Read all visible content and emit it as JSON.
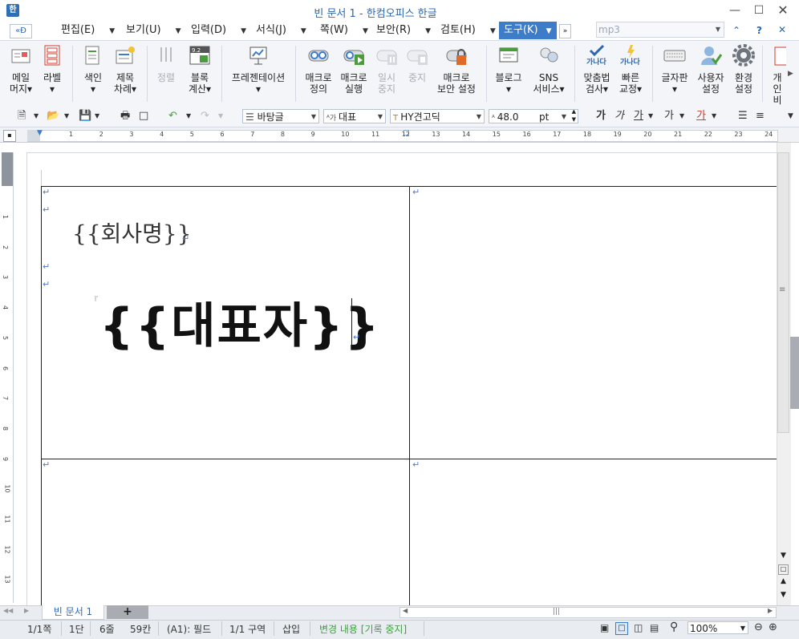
{
  "window": {
    "title": "빈 문서 1 - 한컴오피스 한글",
    "app_icon": "hwp-icon"
  },
  "menu": {
    "items": [
      {
        "label": "편집(E)"
      },
      {
        "label": "보기(U)"
      },
      {
        "label": "입력(D)"
      },
      {
        "label": "서식(J)"
      },
      {
        "label": "쪽(W)"
      },
      {
        "label": "보안(R)"
      },
      {
        "label": "검토(H)"
      },
      {
        "label": "도구(K)",
        "active": true
      }
    ],
    "search_value": "mp3"
  },
  "ribbon": {
    "buttons": [
      {
        "line1": "메일",
        "line2": "머지▾",
        "icon": "mail-merge-icon"
      },
      {
        "line1": "라벨",
        "line2": "▾",
        "icon": "label-icon"
      },
      {
        "line1": "색인",
        "line2": "▾",
        "icon": "index-icon"
      },
      {
        "line1": "제목",
        "line2": "차례▾",
        "icon": "toc-icon"
      },
      {
        "line1": "정렬",
        "line2": "",
        "icon": "sort-icon",
        "disabled": true
      },
      {
        "line1": "블록",
        "line2": "계산▾",
        "icon": "block-calc-icon"
      },
      {
        "line1": "프레젠테이션",
        "line2": "▾",
        "icon": "presentation-icon"
      },
      {
        "line1": "매크로",
        "line2": "정의",
        "icon": "macro-define-icon"
      },
      {
        "line1": "매크로",
        "line2": "실행",
        "icon": "macro-run-icon"
      },
      {
        "line1": "일시",
        "line2": "중지",
        "icon": "pause-icon",
        "disabled": true
      },
      {
        "line1": "중지",
        "line2": "",
        "icon": "stop-icon",
        "disabled": true
      },
      {
        "line1": "매크로",
        "line2": "보안 설정",
        "icon": "macro-security-icon"
      },
      {
        "line1": "블로그",
        "line2": "▾",
        "icon": "blog-icon"
      },
      {
        "line1": "SNS",
        "line2": "서비스▾",
        "icon": "sns-icon"
      },
      {
        "line1": "맞춤법",
        "line2": "검사▾",
        "icon": "spellcheck-icon"
      },
      {
        "line1": "빠른",
        "line2": "교정▾",
        "icon": "quick-correct-icon"
      },
      {
        "line1": "글자판",
        "line2": "▾",
        "icon": "keyboard-icon"
      },
      {
        "line1": "사용자",
        "line2": "설정",
        "icon": "user-settings-icon"
      },
      {
        "line1": "환경",
        "line2": "설정",
        "icon": "settings-gear-icon"
      },
      {
        "line1": "개인",
        "line2": "비",
        "icon": "privacy-icon"
      }
    ]
  },
  "toolbar": {
    "style": "바탕글",
    "language": "대표",
    "font": "HY견고딕",
    "size": "48.0",
    "unit": "pt",
    "char_labels": [
      "가",
      "가",
      "가",
      "가",
      "가"
    ]
  },
  "ruler": {
    "numbers": [
      "1",
      "2",
      "3",
      "4",
      "5",
      "6",
      "7",
      "8",
      "9",
      "10",
      "11",
      "12",
      "13",
      "14",
      "15",
      "16",
      "17",
      "18",
      "19",
      "20",
      "21",
      "22",
      "23",
      "24"
    ]
  },
  "vruler": {
    "numbers": [
      "1",
      "2",
      "3",
      "4",
      "5",
      "6",
      "7",
      "8",
      "9",
      "10",
      "11",
      "12",
      "13"
    ]
  },
  "document": {
    "company_field": "{{회사명}}",
    "representative_field": "{{대표자}}",
    "para_mark": "↵"
  },
  "tabs": {
    "doc_tab": "빈 문서 1",
    "add_tab": "+"
  },
  "status": {
    "page": "1/1쪽",
    "column": "1단",
    "line": "6줄",
    "col": "59칸",
    "field": "(A1): 필드",
    "section": "1/1 구역",
    "insert": "삽입",
    "track": "변경 내용 [기록 중지]",
    "zoom": "100%"
  },
  "colors": {
    "accent": "#3d7cc9",
    "title": "#2c66b0",
    "track": "#3aa13a"
  }
}
